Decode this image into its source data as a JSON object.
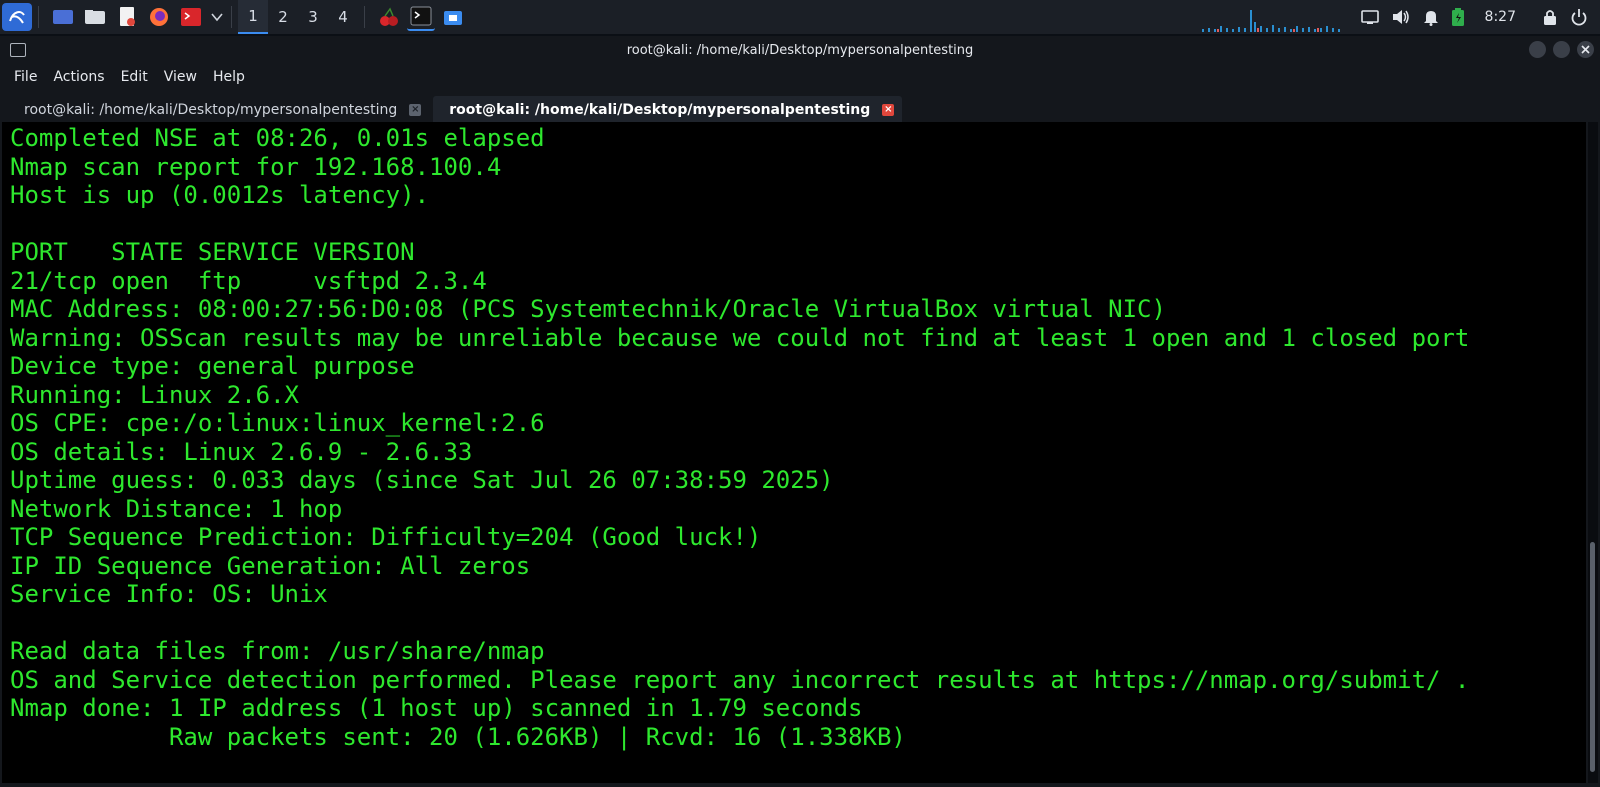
{
  "panel": {
    "workspaces": [
      "1",
      "2",
      "3",
      "4"
    ],
    "clock": "8:27",
    "icons": [
      "kali-menu-icon",
      "desktop-icon",
      "file-manager-icon",
      "text-editor-icon",
      "firefox-icon",
      "terminal-red-icon",
      "chevron-down-icon",
      "cherrytree-icon",
      "terminal-icon",
      "folder-icon"
    ],
    "tray_icons": [
      "screen-icon",
      "volume-icon",
      "bell-icon",
      "battery-icon",
      "lock-icon",
      "power-icon"
    ]
  },
  "window": {
    "title": "root@kali: /home/kali/Desktop/mypersonalpentesting",
    "menu": [
      "File",
      "Actions",
      "Edit",
      "View",
      "Help"
    ],
    "tabs": [
      {
        "label": "root@kali: /home/kali/Desktop/mypersonalpentesting",
        "active": false
      },
      {
        "label": "root@kali: /home/kali/Desktop/mypersonalpentesting",
        "active": true
      }
    ],
    "close_glyph": "×"
  },
  "terminal": {
    "lines": [
      "Completed NSE at 08:26, 0.01s elapsed",
      "Nmap scan report for 192.168.100.4",
      "Host is up (0.0012s latency).",
      "",
      "PORT   STATE SERVICE VERSION",
      "21/tcp open  ftp     vsftpd 2.3.4",
      "MAC Address: 08:00:27:56:D0:08 (PCS Systemtechnik/Oracle VirtualBox virtual NIC)",
      "Warning: OSScan results may be unreliable because we could not find at least 1 open and 1 closed port",
      "Device type: general purpose",
      "Running: Linux 2.6.X",
      "OS CPE: cpe:/o:linux:linux_kernel:2.6",
      "OS details: Linux 2.6.9 - 2.6.33",
      "Uptime guess: 0.033 days (since Sat Jul 26 07:38:59 2025)",
      "Network Distance: 1 hop",
      "TCP Sequence Prediction: Difficulty=204 (Good luck!)",
      "IP ID Sequence Generation: All zeros",
      "Service Info: OS: Unix",
      "",
      "Read data files from: /usr/share/nmap",
      "OS and Service detection performed. Please report any incorrect results at https://nmap.org/submit/ .",
      "Nmap done: 1 IP address (1 host up) scanned in 1.79 seconds",
      "           Raw packets sent: 20 (1.626KB) | Rcvd: 16 (1.338KB)"
    ],
    "text_color": "#2ee82e",
    "background": "#000000"
  }
}
